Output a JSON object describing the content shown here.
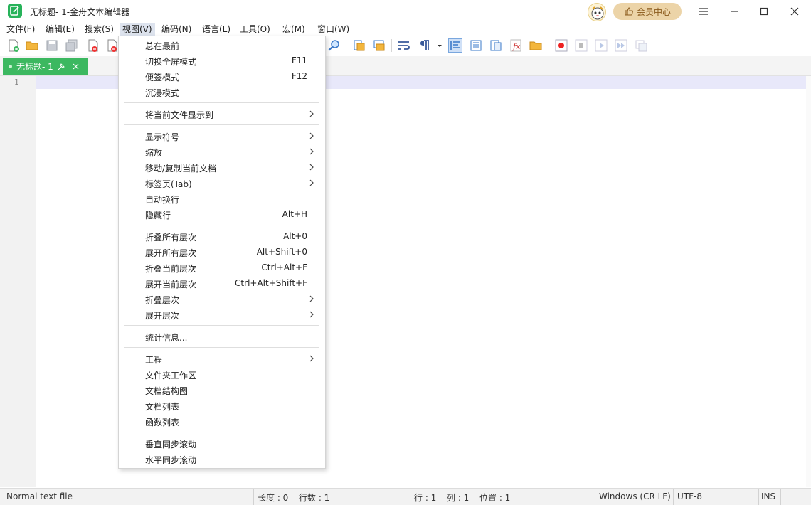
{
  "window": {
    "title": "无标题- 1-金舟文本编辑器",
    "member_label": "会员中心"
  },
  "menubar": [
    {
      "label": "文件(F)"
    },
    {
      "label": "编辑(E)"
    },
    {
      "label": "搜索(S)"
    },
    {
      "label": "视图(V)"
    },
    {
      "label": "编码(N)"
    },
    {
      "label": "语言(L)"
    },
    {
      "label": "工具(O)"
    },
    {
      "label": "宏(M)"
    },
    {
      "label": "窗口(W)"
    }
  ],
  "toolbar_icons": [
    "new-file-icon",
    "open-folder-icon",
    "save-icon",
    "save-all-icon",
    "close-icon",
    "close-all-icon",
    "find-icon",
    "zoom-in-icon",
    "zoom-out-icon",
    "sync-v-icon",
    "sync-h-icon",
    "wrap-icon",
    "show-symbols-icon",
    "dropdown-arrow-icon",
    "indent-guide-icon",
    "doc-map-icon",
    "function-list-icon",
    "folder-workspace-icon",
    "record-macro-icon",
    "stop-macro-icon",
    "play-macro-icon",
    "play-multi-icon",
    "save-macro-icon"
  ],
  "tab": {
    "label": "无标题- 1"
  },
  "editor": {
    "line_number": "1"
  },
  "view_menu": {
    "groups": [
      [
        {
          "label": "总在最前",
          "shortcut": "",
          "submenu": false
        },
        {
          "label": "切换全屏模式",
          "shortcut": "F11",
          "submenu": false
        },
        {
          "label": "便签模式",
          "shortcut": "F12",
          "submenu": false
        },
        {
          "label": "沉浸模式",
          "shortcut": "",
          "submenu": false
        }
      ],
      [
        {
          "label": "将当前文件显示到",
          "shortcut": "",
          "submenu": true
        }
      ],
      [
        {
          "label": "显示符号",
          "shortcut": "",
          "submenu": true
        },
        {
          "label": "缩放",
          "shortcut": "",
          "submenu": true
        },
        {
          "label": "移动/复制当前文档",
          "shortcut": "",
          "submenu": true
        },
        {
          "label": "标签页(Tab)",
          "shortcut": "",
          "submenu": true
        },
        {
          "label": "自动换行",
          "shortcut": "",
          "submenu": false
        },
        {
          "label": "隐藏行",
          "shortcut": "Alt+H",
          "submenu": false
        }
      ],
      [
        {
          "label": "折叠所有层次",
          "shortcut": "Alt+0",
          "submenu": false
        },
        {
          "label": "展开所有层次",
          "shortcut": "Alt+Shift+0",
          "submenu": false
        },
        {
          "label": "折叠当前层次",
          "shortcut": "Ctrl+Alt+F",
          "submenu": false
        },
        {
          "label": "展开当前层次",
          "shortcut": "Ctrl+Alt+Shift+F",
          "submenu": false
        },
        {
          "label": "折叠层次",
          "shortcut": "",
          "submenu": true
        },
        {
          "label": "展开层次",
          "shortcut": "",
          "submenu": true
        }
      ],
      [
        {
          "label": "统计信息...",
          "shortcut": "",
          "submenu": false
        }
      ],
      [
        {
          "label": "工程",
          "shortcut": "",
          "submenu": true
        },
        {
          "label": "文件夹工作区",
          "shortcut": "",
          "submenu": false
        },
        {
          "label": "文档结构图",
          "shortcut": "",
          "submenu": false
        },
        {
          "label": "文档列表",
          "shortcut": "",
          "submenu": false
        },
        {
          "label": "函数列表",
          "shortcut": "",
          "submenu": false
        }
      ],
      [
        {
          "label": "垂直同步滚动",
          "shortcut": "",
          "submenu": false
        },
        {
          "label": "水平同步滚动",
          "shortcut": "",
          "submenu": false
        }
      ]
    ]
  },
  "statusbar": {
    "file_type": "Normal text file",
    "length": "长度 : 0",
    "lines": "行数 : 1",
    "row": "行 : 1",
    "col": "列 : 1",
    "pos": "位置 : 1",
    "eol": "Windows (CR LF)",
    "encoding": "UTF-8",
    "mode": "INS"
  },
  "colors": {
    "accent_green": "#3cb860",
    "current_line": "#e8e8fa",
    "member_bg": "#ecd4a8"
  }
}
